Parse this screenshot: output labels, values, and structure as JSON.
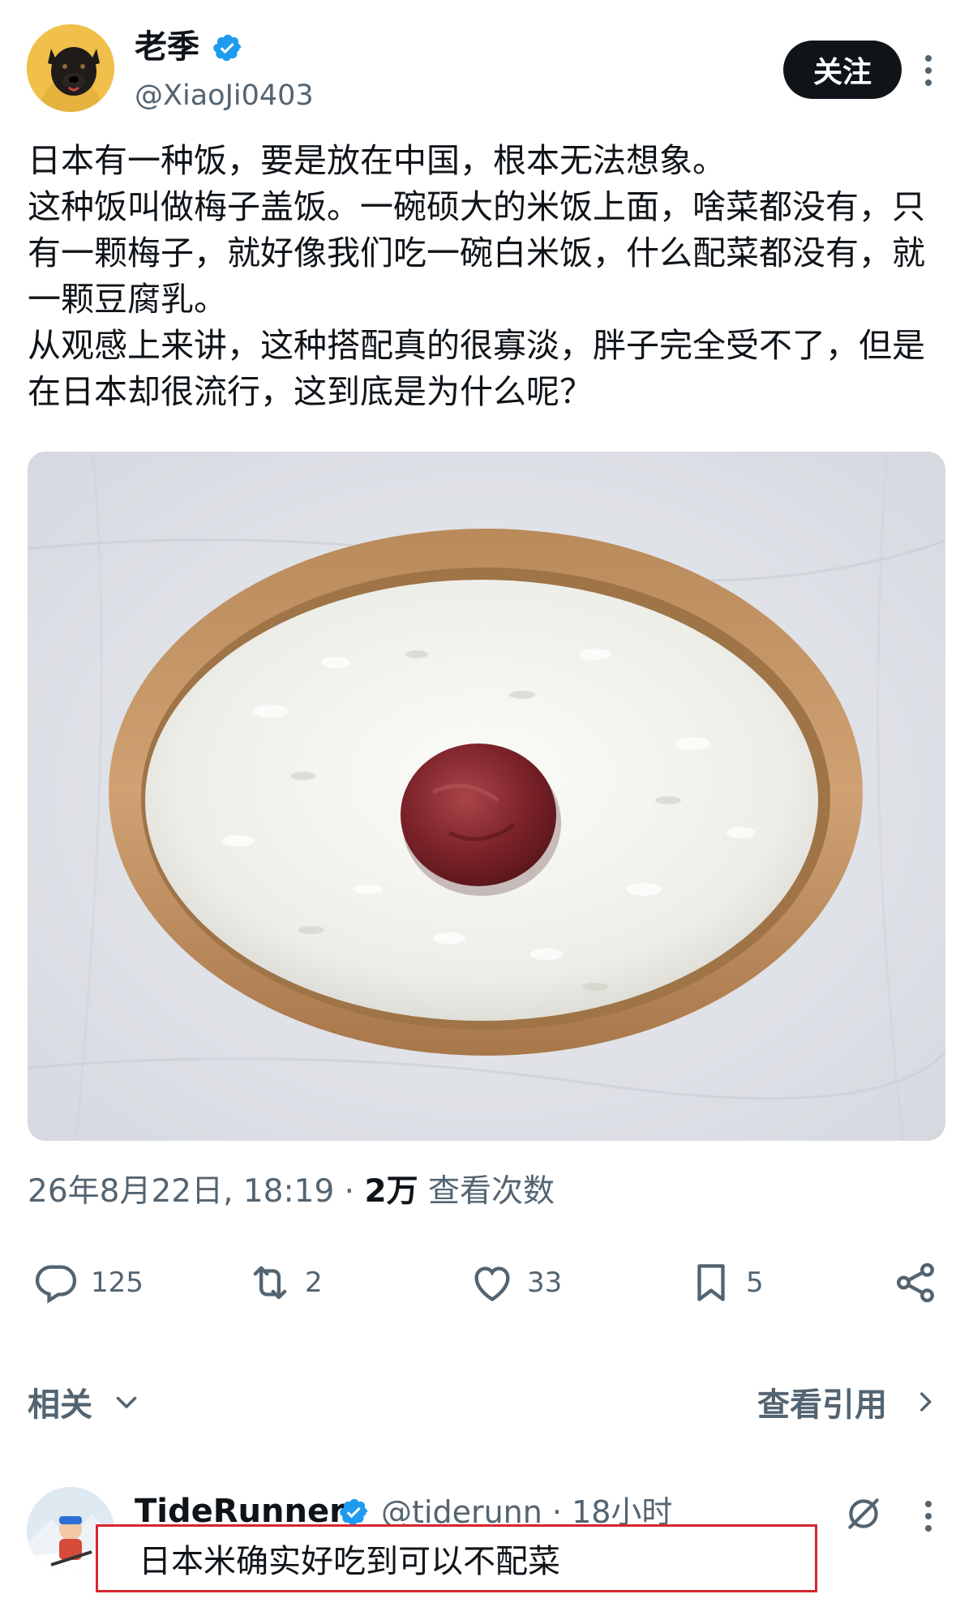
{
  "author": {
    "name": "老季",
    "handle": "@XiaoJi0403",
    "follow_label": "关注"
  },
  "post": {
    "lines": [
      "日本有一种饭，要是放在中国，根本无法想象。",
      "这种饭叫做梅子盖饭。一碗硕大的米饭上面，啥菜都没有，只有一颗梅子，就好像我们吃一碗白米饭，什么配菜都没有，就一颗豆腐乳。",
      "从观感上来讲，这种搭配真的很寡淡，胖子完全受不了，但是在日本却很流行，这到底是为什么呢？"
    ],
    "timestamp": "26年8月22日, 18:19",
    "separator": "·",
    "views_count": "2万",
    "views_label": "查看次数"
  },
  "actions": {
    "replies": "125",
    "retweets": "2",
    "likes": "33",
    "bookmarks": "5"
  },
  "related": {
    "label": "相关",
    "quotes_label": "查看引用"
  },
  "reply": {
    "name": "TideRunner",
    "handle": "@tiderunn · 18小时",
    "text": "日本米确实好吃到可以不配菜"
  },
  "colors": {
    "text": "#0f1419",
    "muted": "#536471",
    "verified": "#1d9bf0",
    "highlight_border": "#d6262f"
  },
  "icons": [
    "verified-badge-icon",
    "more-icon",
    "reply-icon",
    "retweet-icon",
    "like-icon",
    "bookmark-icon",
    "share-icon",
    "chevron-down-icon",
    "chevron-right-icon",
    "grok-icon"
  ]
}
